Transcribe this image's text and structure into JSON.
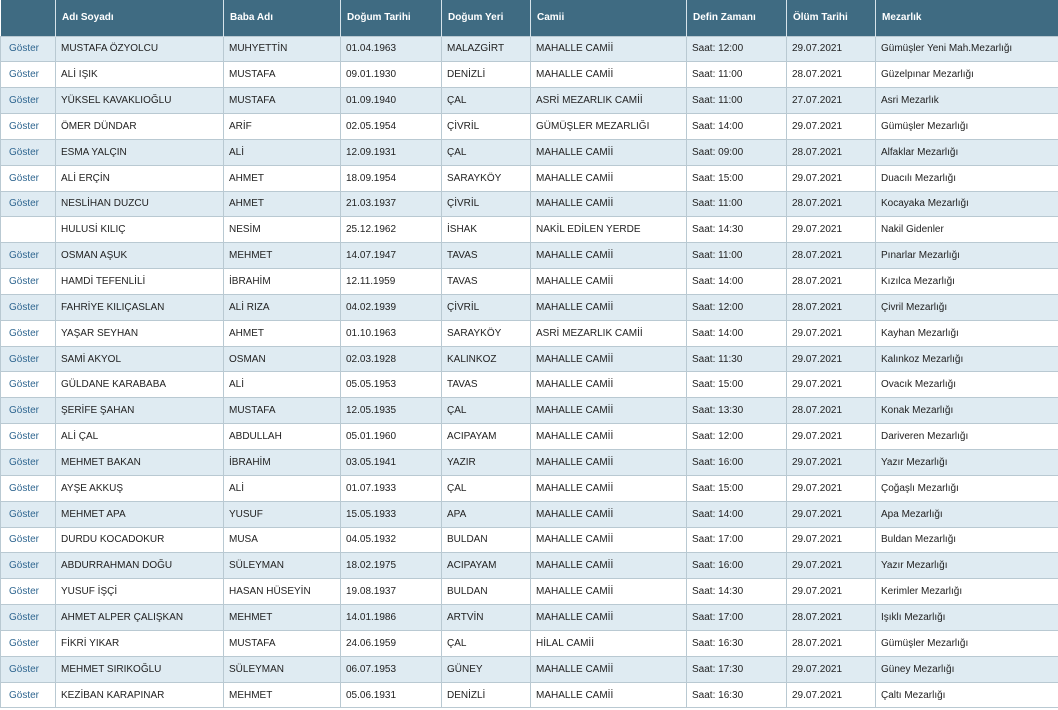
{
  "headers": [
    "",
    "Adı Soyadı",
    "Baba Adı",
    "Doğum Tarihi",
    "Doğum Yeri",
    "Camii",
    "Defin Zamanı",
    "Ölüm Tarihi",
    "Mezarlık"
  ],
  "rows": [
    [
      "Göster",
      "MUSTAFA ÖZYOLCU",
      "MUHYETTİN",
      "01.04.1963",
      "MALAZGİRT",
      "MAHALLE CAMİİ",
      "Saat: 12:00",
      "29.07.2021",
      "Gümüşler Yeni Mah.Mezarlığı"
    ],
    [
      "Göster",
      "ALİ IŞIK",
      "MUSTAFA",
      "09.01.1930",
      "DENİZLİ",
      "MAHALLE CAMİİ",
      "Saat: 11:00",
      "28.07.2021",
      "Güzelpınar Mezarlığı"
    ],
    [
      "Göster",
      "YÜKSEL KAVAKLIOĞLU",
      "MUSTAFA",
      "01.09.1940",
      "ÇAL",
      "ASRİ MEZARLIK CAMİİ",
      "Saat: 11:00",
      "27.07.2021",
      "Asri Mezarlık"
    ],
    [
      "Göster",
      "ÖMER DÜNDAR",
      "ARİF",
      "02.05.1954",
      "ÇİVRİL",
      "GÜMÜŞLER MEZARLIĞI",
      "Saat: 14:00",
      "29.07.2021",
      "Gümüşler Mezarlığı"
    ],
    [
      "Göster",
      "ESMA YALÇIN",
      "ALİ",
      "12.09.1931",
      "ÇAL",
      "MAHALLE CAMİİ",
      "Saat: 09:00",
      "28.07.2021",
      "Alfaklar Mezarlığı"
    ],
    [
      "Göster",
      "ALİ ERÇİN",
      "AHMET",
      "18.09.1954",
      "SARAYKÖY",
      "MAHALLE CAMİİ",
      "Saat: 15:00",
      "29.07.2021",
      "Duacılı Mezarlığı"
    ],
    [
      "Göster",
      "NESLİHAN DUZCU",
      "AHMET",
      "21.03.1937",
      "ÇİVRİL",
      "MAHALLE CAMİİ",
      "Saat: 11:00",
      "28.07.2021",
      "Kocayaka Mezarlığı"
    ],
    [
      "",
      "HULUSİ KILIÇ",
      "NESİM",
      "25.12.1962",
      "İSHAK",
      "NAKİL EDİLEN YERDE",
      "Saat: 14:30",
      "29.07.2021",
      "Nakil Gidenler"
    ],
    [
      "Göster",
      "OSMAN AŞUK",
      "MEHMET",
      "14.07.1947",
      "TAVAS",
      "MAHALLE CAMİİ",
      "Saat: 11:00",
      "28.07.2021",
      "Pınarlar Mezarlığı"
    ],
    [
      "Göster",
      "HAMDİ TEFENLİLİ",
      "İBRAHİM",
      "12.11.1959",
      "TAVAS",
      "MAHALLE CAMİİ",
      "Saat: 14:00",
      "28.07.2021",
      "Kızılca Mezarlığı"
    ],
    [
      "Göster",
      "FAHRİYE KILIÇASLAN",
      "ALİ RIZA",
      "04.02.1939",
      "ÇİVRİL",
      "MAHALLE CAMİİ",
      "Saat: 12:00",
      "28.07.2021",
      "Çivril Mezarlığı"
    ],
    [
      "Göster",
      "YAŞAR SEYHAN",
      "AHMET",
      "01.10.1963",
      "SARAYKÖY",
      "ASRİ MEZARLIK CAMİİ",
      "Saat: 14:00",
      "29.07.2021",
      "Kayhan Mezarlığı"
    ],
    [
      "Göster",
      "SAMİ AKYOL",
      "OSMAN",
      "02.03.1928",
      "KALINKOZ",
      "MAHALLE CAMİİ",
      "Saat: 11:30",
      "29.07.2021",
      "Kalınkoz Mezarlığı"
    ],
    [
      "Göster",
      "GÜLDANE KARABABA",
      "ALİ",
      "05.05.1953",
      "TAVAS",
      "MAHALLE CAMİİ",
      "Saat: 15:00",
      "29.07.2021",
      "Ovacık Mezarlığı"
    ],
    [
      "Göster",
      "ŞERİFE ŞAHAN",
      "MUSTAFA",
      "12.05.1935",
      "ÇAL",
      "MAHALLE CAMİİ",
      "Saat: 13:30",
      "28.07.2021",
      "Konak Mezarlığı"
    ],
    [
      "Göster",
      "ALİ ÇAL",
      "ABDULLAH",
      "05.01.1960",
      "ACIPAYAM",
      "MAHALLE CAMİİ",
      "Saat: 12:00",
      "29.07.2021",
      "Dariveren Mezarlığı"
    ],
    [
      "Göster",
      "MEHMET BAKAN",
      "İBRAHİM",
      "03.05.1941",
      "YAZIR",
      "MAHALLE CAMİİ",
      "Saat: 16:00",
      "29.07.2021",
      "Yazır Mezarlığı"
    ],
    [
      "Göster",
      "AYŞE AKKUŞ",
      "ALİ",
      "01.07.1933",
      "ÇAL",
      "MAHALLE CAMİİ",
      "Saat: 15:00",
      "29.07.2021",
      "Çoğaşlı Mezarlığı"
    ],
    [
      "Göster",
      "MEHMET APA",
      "YUSUF",
      "15.05.1933",
      "APA",
      "MAHALLE CAMİİ",
      "Saat: 14:00",
      "29.07.2021",
      "Apa Mezarlığı"
    ],
    [
      "Göster",
      "DURDU KOCADOKUR",
      "MUSA",
      "04.05.1932",
      "BULDAN",
      "MAHALLE CAMİİ",
      "Saat: 17:00",
      "29.07.2021",
      "Buldan Mezarlığı"
    ],
    [
      "Göster",
      "ABDURRAHMAN DOĞU",
      "SÜLEYMAN",
      "18.02.1975",
      "ACIPAYAM",
      "MAHALLE CAMİİ",
      "Saat: 16:00",
      "29.07.2021",
      "Yazır Mezarlığı"
    ],
    [
      "Göster",
      "YUSUF İŞÇİ",
      "HASAN HÜSEYİN",
      "19.08.1937",
      "BULDAN",
      "MAHALLE CAMİİ",
      "Saat: 14:30",
      "29.07.2021",
      "Kerimler Mezarlığı"
    ],
    [
      "Göster",
      "AHMET ALPER ÇALIŞKAN",
      "MEHMET",
      "14.01.1986",
      "ARTVİN",
      "MAHALLE CAMİİ",
      "Saat: 17:00",
      "28.07.2021",
      "Işıklı Mezarlığı"
    ],
    [
      "Göster",
      "FİKRİ YIKAR",
      "MUSTAFA",
      "24.06.1959",
      "ÇAL",
      "HİLAL CAMİİ",
      "Saat: 16:30",
      "28.07.2021",
      "Gümüşler Mezarlığı"
    ],
    [
      "Göster",
      "MEHMET SIRIKOĞLU",
      "SÜLEYMAN",
      "06.07.1953",
      "GÜNEY",
      "MAHALLE CAMİİ",
      "Saat: 17:30",
      "29.07.2021",
      "Güney Mezarlığı"
    ],
    [
      "Göster",
      "KEZİBAN KARAPINAR",
      "MEHMET",
      "05.06.1931",
      "DENİZLİ",
      "MAHALLE CAMİİ",
      "Saat: 16:30",
      "29.07.2021",
      "Çaltı Mezarlığı"
    ]
  ]
}
